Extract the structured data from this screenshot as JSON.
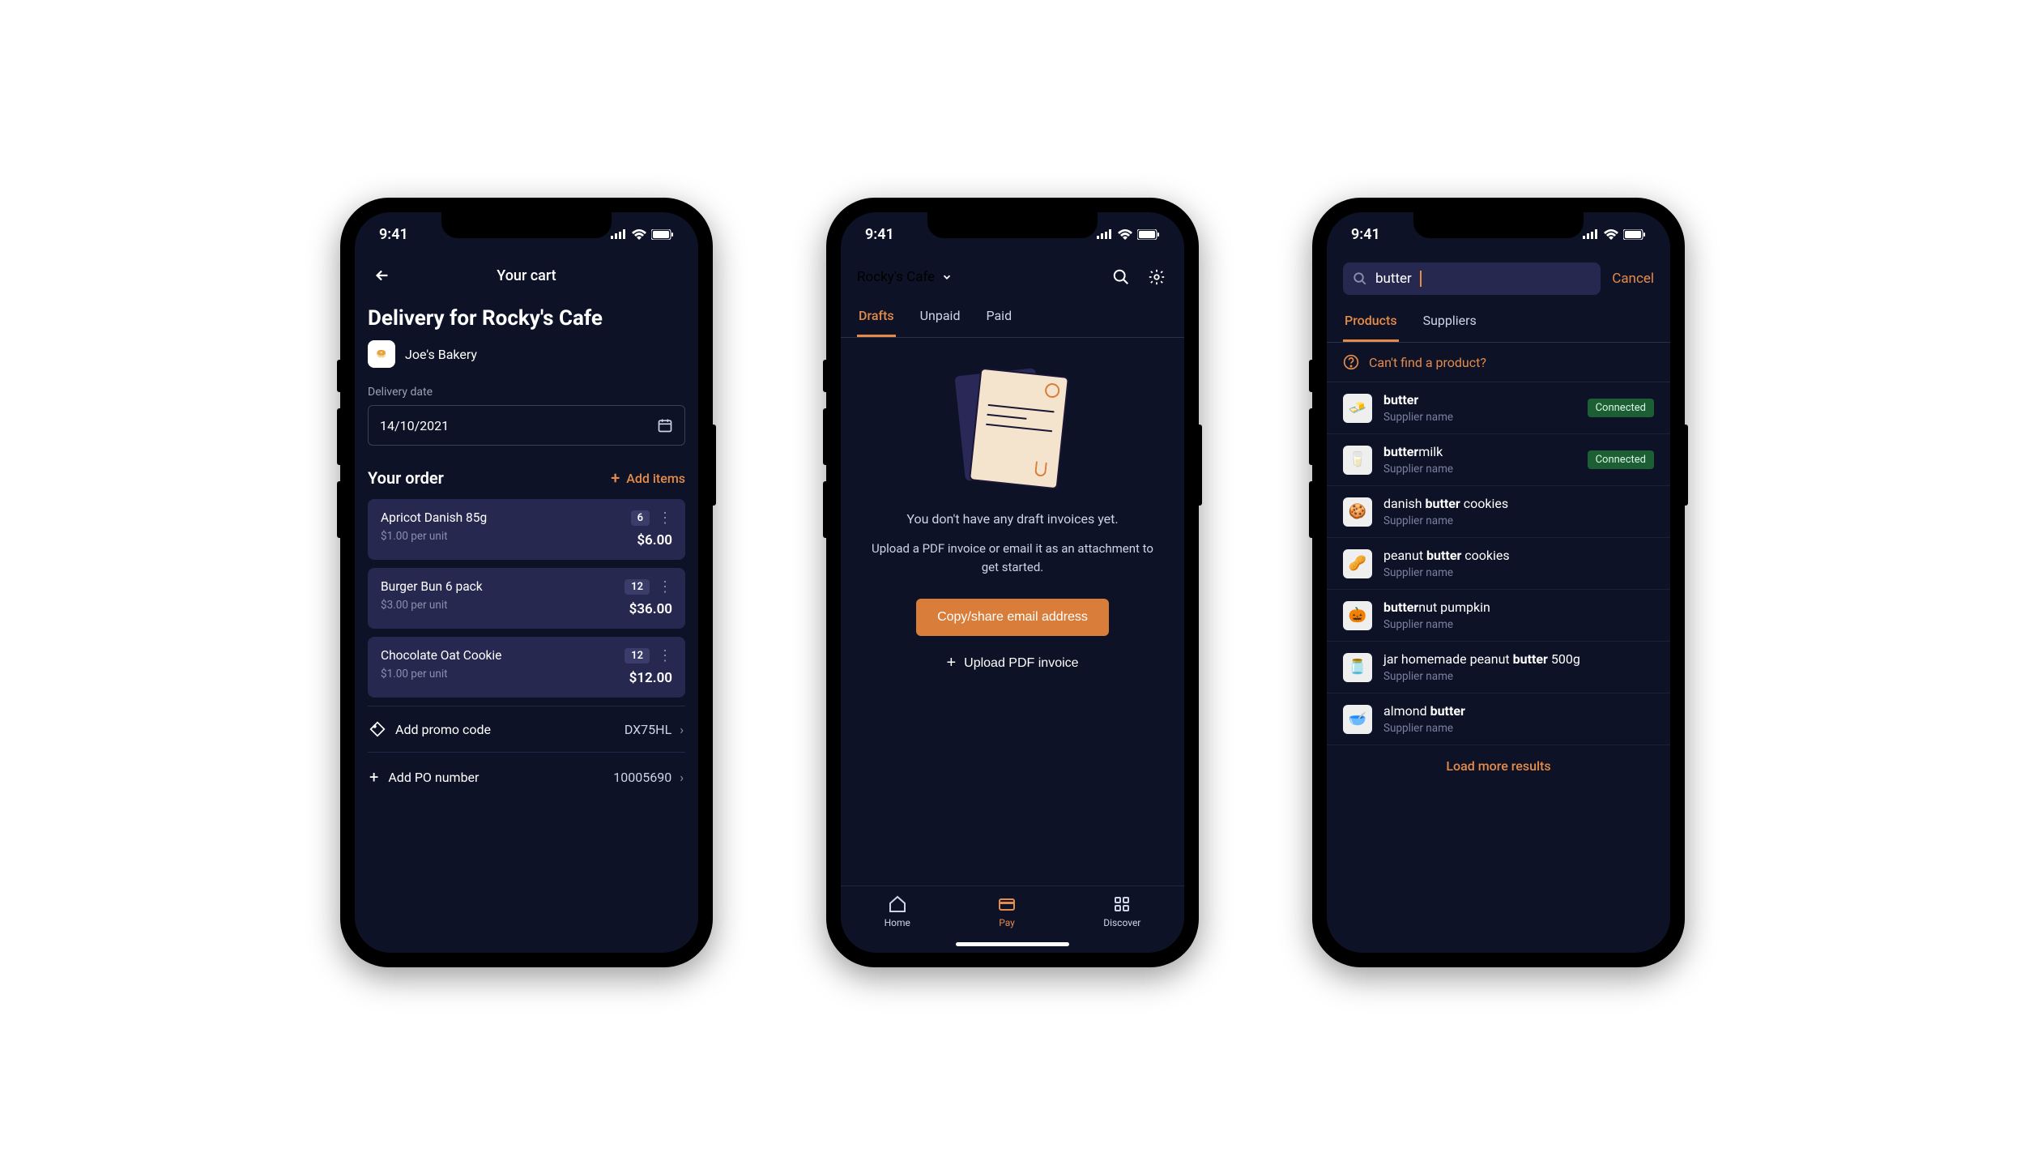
{
  "status_bar": {
    "time": "9:41"
  },
  "screen1": {
    "header_title": "Your cart",
    "heading": "Delivery for Rocky's Cafe",
    "supplier": "Joe's Bakery",
    "date_label": "Delivery date",
    "date_value": "14/10/2021",
    "order_section": "Your order",
    "add_items": "Add items",
    "items": [
      {
        "name": "Apricot Danish 85g",
        "unit_price": "$1.00 per unit",
        "qty": "6",
        "total": "$6.00"
      },
      {
        "name": "Burger Bun 6 pack",
        "unit_price": "$3.00 per unit",
        "qty": "12",
        "total": "$36.00"
      },
      {
        "name": "Chocolate Oat Cookie",
        "unit_price": "$1.00 per unit",
        "qty": "12",
        "total": "$12.00"
      }
    ],
    "promo_label": "Add promo code",
    "promo_value": "DX75HL",
    "po_label": "Add PO number",
    "po_value": "10005690"
  },
  "screen2": {
    "venue": "Rocky's Cafe",
    "tabs": [
      "Drafts",
      "Unpaid",
      "Paid"
    ],
    "active_tab": 0,
    "empty_line1": "You don't have any draft invoices yet.",
    "empty_line2": "Upload a PDF invoice or email it as an attachment to get started.",
    "primary_btn": "Copy/share email address",
    "secondary_btn": "Upload PDF invoice",
    "nav": [
      "Home",
      "Pay",
      "Discover"
    ],
    "active_nav": 1
  },
  "screen3": {
    "query": "butter",
    "cancel": "Cancel",
    "tabs": [
      "Products",
      "Suppliers"
    ],
    "active_tab": 0,
    "help_text": "Can't find a product?",
    "supplier_label": "Supplier name",
    "connected": "Connected",
    "load_more": "Load more results",
    "results": [
      {
        "pre": "",
        "match": "butter",
        "post": "",
        "connected": true,
        "emoji": "🧈"
      },
      {
        "pre": "",
        "match": "butter",
        "post": "milk",
        "connected": true,
        "emoji": "🥛"
      },
      {
        "pre": "danish ",
        "match": "butter",
        "post": " cookies",
        "connected": false,
        "emoji": "🍪"
      },
      {
        "pre": "peanut ",
        "match": "butter",
        "post": " cookies",
        "connected": false,
        "emoji": "🥜"
      },
      {
        "pre": "",
        "match": "butter",
        "post": "nut pumpkin",
        "connected": false,
        "emoji": "🎃"
      },
      {
        "pre": "jar homemade peanut ",
        "match": "butter",
        "post": " 500g",
        "connected": false,
        "emoji": "🫙"
      },
      {
        "pre": "almond ",
        "match": "butter",
        "post": "",
        "connected": false,
        "emoji": "🥣"
      }
    ]
  }
}
